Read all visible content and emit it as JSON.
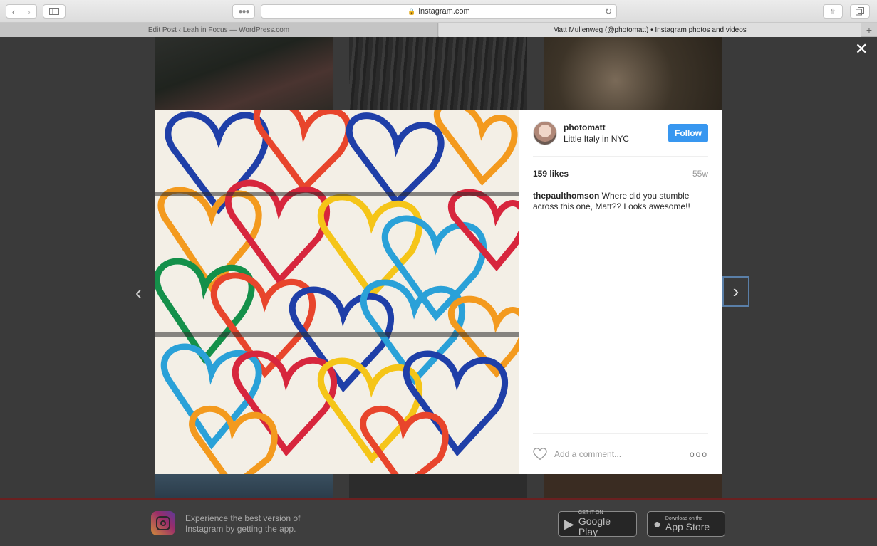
{
  "browser": {
    "address": "instagram.com",
    "tabs": [
      {
        "label": "Edit Post ‹ Leah in Focus — WordPress.com"
      },
      {
        "label": "Matt Mullenweg (@photomatt) • Instagram photos and videos"
      }
    ],
    "icons": [
      "chevron-left-icon",
      "chevron-right-icon",
      "sidebar-icon",
      "reader-icon",
      "lock-icon",
      "reload-icon",
      "share-icon",
      "tabs-icon",
      "plus-icon"
    ]
  },
  "modal": {
    "username": "photomatt",
    "location": "Little Italy in NYC",
    "follow_label": "Follow",
    "likes": "159 likes",
    "age": "55w",
    "comments": [
      {
        "author": "thepaulthomson",
        "text": "Where did you stumble across this one, Matt?? Looks awesome!!"
      }
    ],
    "add_comment_placeholder": "Add a comment...",
    "more_label": "ooo",
    "follow_color": "#3897f0"
  },
  "banner": {
    "text": "Experience the best version of Instagram by getting the app.",
    "google_play_small": "GET IT ON",
    "google_play_big": "Google Play",
    "app_store_small": "Download on the",
    "app_store_big": "App Store"
  }
}
